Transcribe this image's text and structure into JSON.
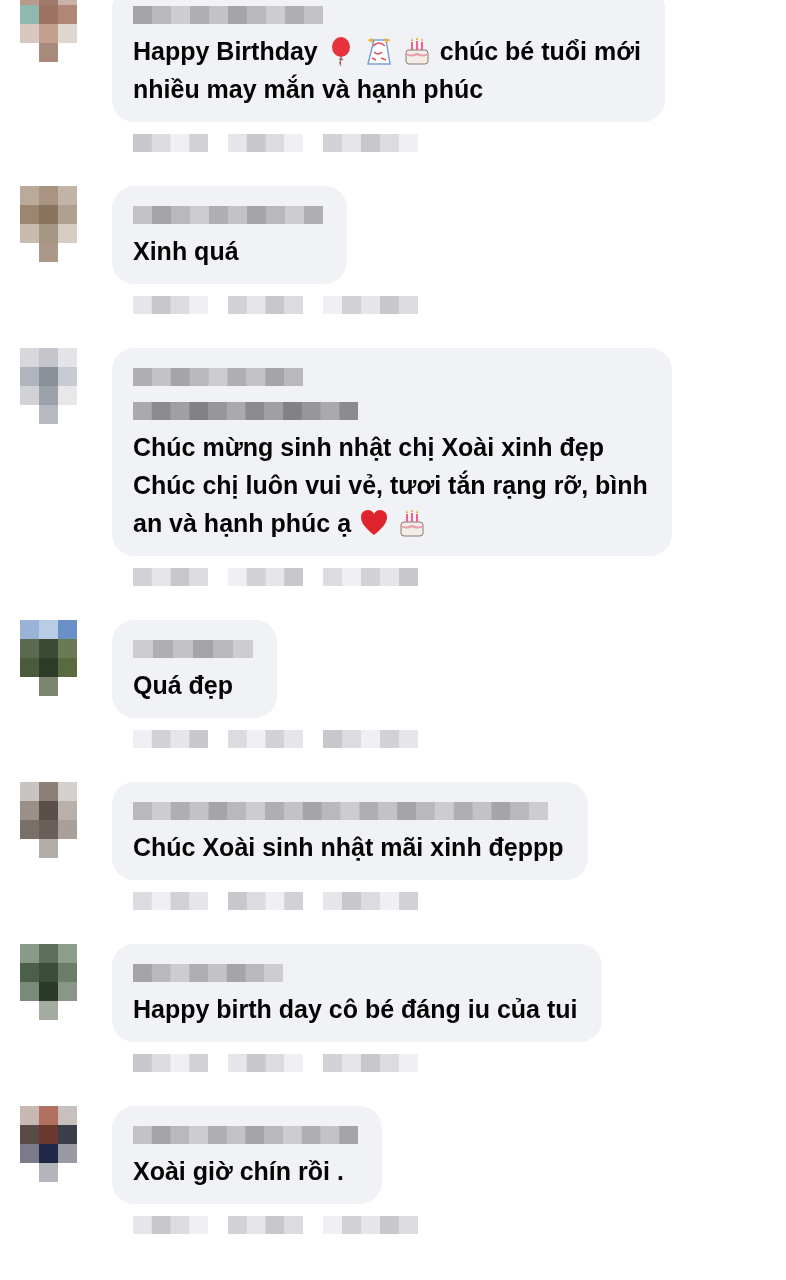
{
  "comments": [
    {
      "lines": [
        [
          {
            "kind": "text",
            "text": "Happy Birthday"
          },
          {
            "kind": "balloon"
          },
          {
            "kind": "confetti"
          },
          {
            "kind": "cake"
          },
          {
            "kind": "text",
            "text": "chúc bé tuổi mới"
          }
        ],
        [
          {
            "kind": "text",
            "text": "nhiều may mắn và hạnh phúc"
          }
        ]
      ]
    },
    {
      "lines": [
        [
          {
            "kind": "text",
            "text": "Xinh quá"
          }
        ]
      ]
    },
    {
      "lines": [
        [
          {
            "kind": "text",
            "text": "Chúc mừng sinh nhật chị Xoài xinh đẹp"
          }
        ],
        [
          {
            "kind": "text",
            "text": "Chúc chị luôn vui vẻ, tươi tắn rạng rỡ, bình"
          }
        ],
        [
          {
            "kind": "text",
            "text": "an và hạnh phúc ạ"
          },
          {
            "kind": "heart"
          },
          {
            "kind": "cake"
          }
        ]
      ]
    },
    {
      "lines": [
        [
          {
            "kind": "text",
            "text": "Quá đẹp"
          }
        ]
      ]
    },
    {
      "lines": [
        [
          {
            "kind": "text",
            "text": "Chúc Xoài sinh nhật mãi xinh đẹppp"
          }
        ]
      ]
    },
    {
      "lines": [
        [
          {
            "kind": "text",
            "text": "Happy birth day cô bé đáng iu của tui"
          }
        ]
      ]
    },
    {
      "lines": [
        [
          {
            "kind": "text",
            "text": "Xoài giờ chín rồi ."
          }
        ]
      ]
    }
  ]
}
